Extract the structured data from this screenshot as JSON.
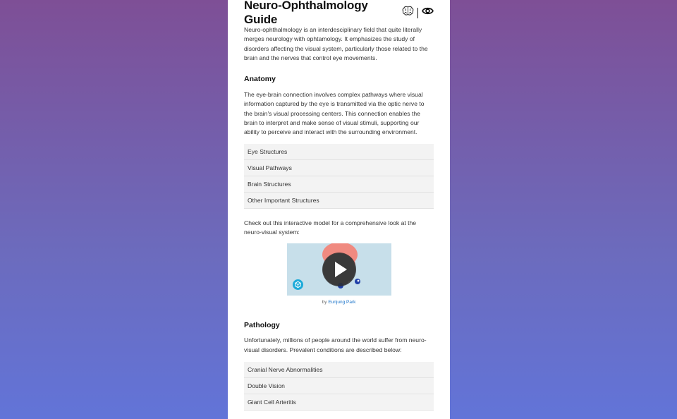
{
  "header": {
    "title": "Neuro-Ophthalmology Guide",
    "icons": [
      "brain-icon",
      "eye-icon"
    ]
  },
  "intro": "Neuro-ophthalmology is an interdesciplinary field that quite literally merges neurology with ophtamology. It emphasizes the study of disorders affecting the visual system, particularly those related to the brain and the nerves that control eye movements.",
  "anatomy": {
    "heading": "Anatomy",
    "text": "The eye-brain connection involves complex pathways where visual information captured by the eye is transmitted via the optic nerve to the brain's visual processing centers. This connection enables the brain to interpret and make sense of visual stimuli, supporting our ability to perceive and interact with the surrounding environment.",
    "items": [
      "Eye Structures",
      "Visual Pathways",
      "Brain Structures",
      "Other Important Structures"
    ]
  },
  "model": {
    "text": "Check out this interactive model for a comprehensive look at the neuro-visual system:",
    "caption_prefix": "by",
    "author": "Eunjung Park"
  },
  "pathology": {
    "heading": "Pathology",
    "text": "Unfortunately, millions of people around the world suffer from neuro-visual disorders. Prevalent conditions are described below:",
    "items": [
      "Cranial Nerve Abnormalities",
      "Double Vision",
      "Giant Cell Arteritis"
    ]
  },
  "colors": {
    "accent_link": "#1a73c9",
    "background_top": "#7e4f96",
    "background_bottom": "#6274d8"
  }
}
